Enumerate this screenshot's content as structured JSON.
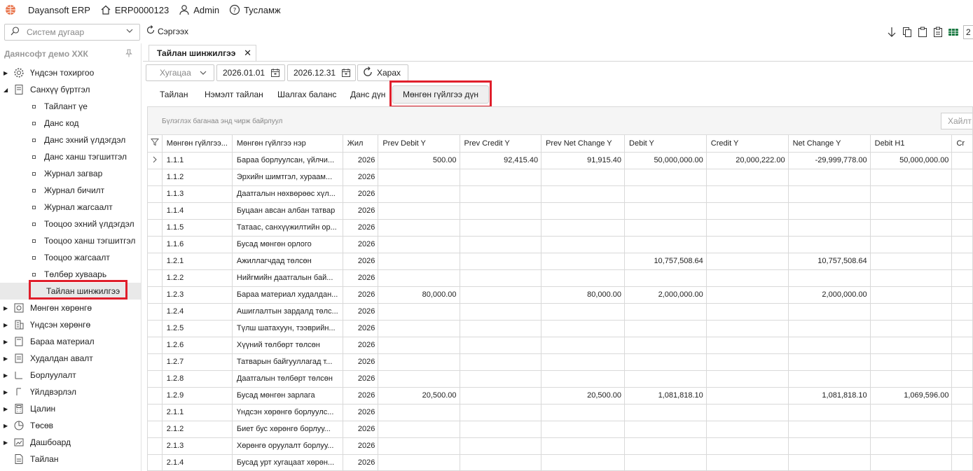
{
  "topbar": {
    "app_name": "Dayansoft ERP",
    "record": "ERP0000123",
    "user": "Admin",
    "help": "Тусламж"
  },
  "toolbar": {
    "system_placeholder": "Систем дугаар",
    "refresh_label": "Сэргээх",
    "page_number": "2"
  },
  "sidebar": {
    "company": "Даянсофт демо ХХК",
    "items": [
      {
        "label": "Үндсэн тохиргоо"
      },
      {
        "label": "Санхүү бүртгэл"
      }
    ],
    "sub_items": [
      {
        "label": "Тайлант үе"
      },
      {
        "label": "Данс код"
      },
      {
        "label": "Данс эхний үлдэгдэл"
      },
      {
        "label": "Данс ханш тэгшитгэл"
      },
      {
        "label": "Журнал загвар"
      },
      {
        "label": "Журнал бичилт"
      },
      {
        "label": "Журнал жагсаалт"
      },
      {
        "label": "Тооцоо эхний үлдэгдэл"
      },
      {
        "label": "Тооцоо ханш тэгшитгэл"
      },
      {
        "label": "Тооцоо жагсаалт"
      },
      {
        "label": "Төлбөр хуваарь"
      },
      {
        "label": "Тайлан шинжилгээ"
      }
    ],
    "modules": [
      {
        "label": "Мөнгөн хөрөнгө"
      },
      {
        "label": "Үндсэн хөрөнгө"
      },
      {
        "label": "Бараа материал"
      },
      {
        "label": "Худалдан авалт"
      },
      {
        "label": "Борлуулалт"
      },
      {
        "label": "Үйлдвэрлэл"
      },
      {
        "label": "Цалин"
      },
      {
        "label": "Төсөв"
      },
      {
        "label": "Дашбоард"
      },
      {
        "label": "Тайлан"
      }
    ]
  },
  "document_tab": {
    "title": "Тайлан шинжилгээ"
  },
  "filters": {
    "period": "Хугацаа",
    "date_from": "2026.01.01",
    "date_to": "2026.12.31",
    "view_label": "Харах"
  },
  "report_tabs": [
    "Тайлан",
    "Нэмэлт тайлан",
    "Шалгах баланс",
    "Данс дүн",
    "Мөнгөн гүйлгээ дүн"
  ],
  "grid": {
    "group_hint": "Бүлэглэх баганаа энд чирж байрлуул",
    "search_placeholder": "Хайлт",
    "columns": [
      "Мөнгөн гүйлгээ...",
      "Мөнгөн гүйлгээ нэр",
      "Жил",
      "Prev Debit Y",
      "Prev Credit Y",
      "Prev Net Change Y",
      "Debit Y",
      "Credit Y",
      "Net Change Y",
      "Debit H1",
      "Cr"
    ],
    "rows": [
      {
        "code": "1.1.1",
        "name": "Бараа борлуулсан, үйлчи...",
        "year": "2026",
        "prev_debit": "500.00",
        "prev_credit": "92,415.40",
        "prev_net": "91,915.40",
        "debit": "50,000,000.00",
        "credit": "20,000,222.00",
        "net": "-29,999,778.00",
        "debit_h1": "50,000,000.00"
      },
      {
        "code": "1.1.2",
        "name": "Эрхийн шимтгэл, хураам...",
        "year": "2026",
        "prev_debit": "",
        "prev_credit": "",
        "prev_net": "",
        "debit": "",
        "credit": "",
        "net": "",
        "debit_h1": ""
      },
      {
        "code": "1.1.3",
        "name": "Даатгалын нөхвөрөөс хүл...",
        "year": "2026",
        "prev_debit": "",
        "prev_credit": "",
        "prev_net": "",
        "debit": "",
        "credit": "",
        "net": "",
        "debit_h1": ""
      },
      {
        "code": "1.1.4",
        "name": "Буцаан авсан албан татвар",
        "year": "2026",
        "prev_debit": "",
        "prev_credit": "",
        "prev_net": "",
        "debit": "",
        "credit": "",
        "net": "",
        "debit_h1": ""
      },
      {
        "code": "1.1.5",
        "name": "Татаас, санхүүжилтийн ор...",
        "year": "2026",
        "prev_debit": "",
        "prev_credit": "",
        "prev_net": "",
        "debit": "",
        "credit": "",
        "net": "",
        "debit_h1": ""
      },
      {
        "code": "1.1.6",
        "name": "Бусад мөнгөн орлого",
        "year": "2026",
        "prev_debit": "",
        "prev_credit": "",
        "prev_net": "",
        "debit": "",
        "credit": "",
        "net": "",
        "debit_h1": ""
      },
      {
        "code": "1.2.1",
        "name": "Ажиллагчдад төлсөн",
        "year": "2026",
        "prev_debit": "",
        "prev_credit": "",
        "prev_net": "",
        "debit": "10,757,508.64",
        "credit": "",
        "net": "10,757,508.64",
        "debit_h1": ""
      },
      {
        "code": "1.2.2",
        "name": "Нийгмийн даатгалын бай...",
        "year": "2026",
        "prev_debit": "",
        "prev_credit": "",
        "prev_net": "",
        "debit": "",
        "credit": "",
        "net": "",
        "debit_h1": ""
      },
      {
        "code": "1.2.3",
        "name": "Бараа материал худалдан...",
        "year": "2026",
        "prev_debit": "80,000.00",
        "prev_credit": "",
        "prev_net": "80,000.00",
        "debit": "2,000,000.00",
        "credit": "",
        "net": "2,000,000.00",
        "debit_h1": ""
      },
      {
        "code": "1.2.4",
        "name": "Ашиглалтын зардалд төлс...",
        "year": "2026",
        "prev_debit": "",
        "prev_credit": "",
        "prev_net": "",
        "debit": "",
        "credit": "",
        "net": "",
        "debit_h1": ""
      },
      {
        "code": "1.2.5",
        "name": "Түлш шатахуун, тээврийн...",
        "year": "2026",
        "prev_debit": "",
        "prev_credit": "",
        "prev_net": "",
        "debit": "",
        "credit": "",
        "net": "",
        "debit_h1": ""
      },
      {
        "code": "1.2.6",
        "name": "Хүүний төлбөрт төлсөн",
        "year": "2026",
        "prev_debit": "",
        "prev_credit": "",
        "prev_net": "",
        "debit": "",
        "credit": "",
        "net": "",
        "debit_h1": ""
      },
      {
        "code": "1.2.7",
        "name": "Татварын байгууллагад т...",
        "year": "2026",
        "prev_debit": "",
        "prev_credit": "",
        "prev_net": "",
        "debit": "",
        "credit": "",
        "net": "",
        "debit_h1": ""
      },
      {
        "code": "1.2.8",
        "name": "Даатгалын төлбөрт төлсөн",
        "year": "2026",
        "prev_debit": "",
        "prev_credit": "",
        "prev_net": "",
        "debit": "",
        "credit": "",
        "net": "",
        "debit_h1": ""
      },
      {
        "code": "1.2.9",
        "name": "Бусад мөнгөн зарлага",
        "year": "2026",
        "prev_debit": "20,500.00",
        "prev_credit": "",
        "prev_net": "20,500.00",
        "debit": "1,081,818.10",
        "credit": "",
        "net": "1,081,818.10",
        "debit_h1": "1,069,596.00"
      },
      {
        "code": "2.1.1",
        "name": "Үндсэн хөрөнгө борлуулс...",
        "year": "2026",
        "prev_debit": "",
        "prev_credit": "",
        "prev_net": "",
        "debit": "",
        "credit": "",
        "net": "",
        "debit_h1": ""
      },
      {
        "code": "2.1.2",
        "name": "Биет бус хөрөнгө борлуу...",
        "year": "2026",
        "prev_debit": "",
        "prev_credit": "",
        "prev_net": "",
        "debit": "",
        "credit": "",
        "net": "",
        "debit_h1": ""
      },
      {
        "code": "2.1.3",
        "name": "Хөрөнгө оруулалт борлуу...",
        "year": "2026",
        "prev_debit": "",
        "prev_credit": "",
        "prev_net": "",
        "debit": "",
        "credit": "",
        "net": "",
        "debit_h1": ""
      },
      {
        "code": "2.1.4",
        "name": "Бусад урт хугацаат хөрөн...",
        "year": "2026",
        "prev_debit": "",
        "prev_credit": "",
        "prev_net": "",
        "debit": "",
        "credit": "",
        "net": "",
        "debit_h1": ""
      }
    ]
  },
  "colors": {
    "highlight": "#e01e2b",
    "logo": "#e8734a",
    "active_bg": "#e9e9e9"
  }
}
